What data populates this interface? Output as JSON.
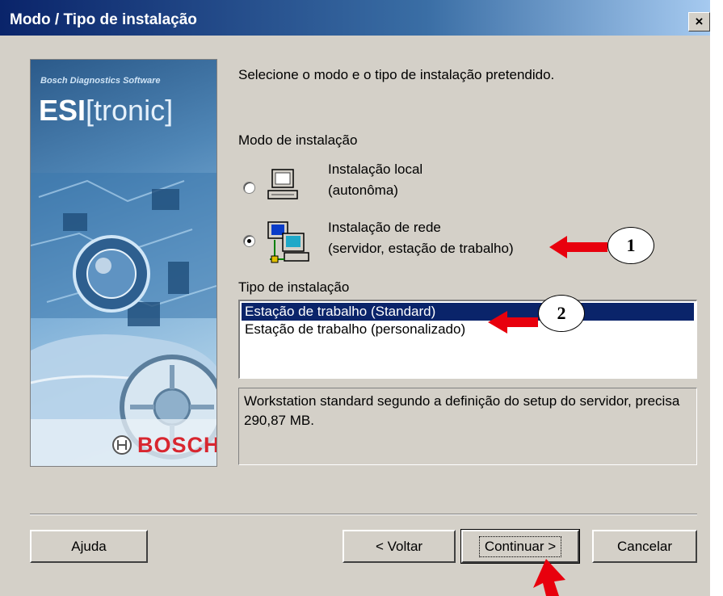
{
  "window": {
    "title": "Modo / Tipo de instalação",
    "close_glyph": "×"
  },
  "banner": {
    "subtitle": "Bosch Diagnostics Software",
    "logo_bold": "ESI",
    "logo_bracket": "[tronic]",
    "brand": "BOSCH"
  },
  "main": {
    "instruction": "Selecione o modo e o tipo de instalação pretendido.",
    "mode_heading": "Modo de instalação",
    "modes": [
      {
        "line1": "Instalação local",
        "line2": "(autonôma)",
        "selected": false,
        "icon": "computer-icon"
      },
      {
        "line1": "Instalação de rede",
        "line2": "(servidor, estação de trabalho)",
        "selected": true,
        "icon": "network-computers-icon"
      }
    ],
    "type_heading": "Tipo de instalação",
    "types": [
      {
        "label": "Estação de trabalho (Standard)",
        "selected": true
      },
      {
        "label": "Estação de trabalho (personalizado)",
        "selected": false
      }
    ],
    "description": "Workstation standard segundo a definição do setup do servidor, precisa 290,87 MB."
  },
  "buttons": {
    "help": "Ajuda",
    "back": "< Voltar",
    "continue": "Continuar >",
    "cancel": "Cancelar"
  },
  "annotations": {
    "callout_1": "1",
    "callout_2": "2",
    "arrow_color": "#e8000d"
  }
}
